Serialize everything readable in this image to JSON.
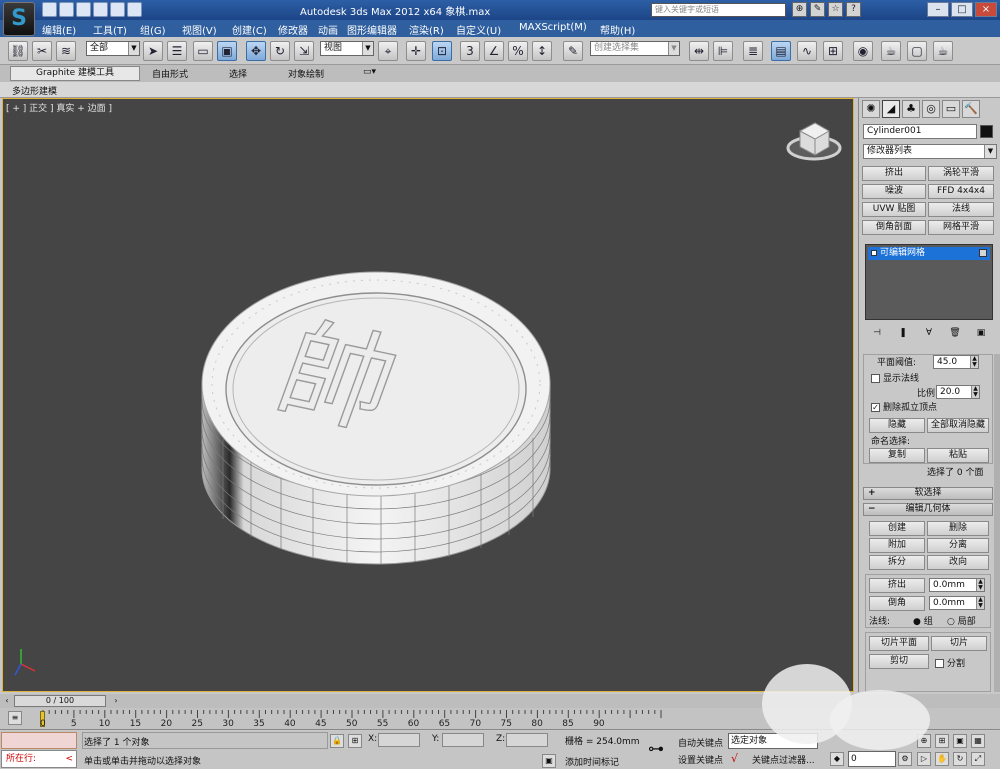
{
  "window": {
    "title": "Autodesk 3ds Max  2012 x64      象棋.max",
    "search_placeholder": "键入关键字或短语",
    "logo": "S"
  },
  "menu": [
    "编辑(E)",
    "工具(T)",
    "组(G)",
    "视图(V)",
    "创建(C)",
    "修改器",
    "动画",
    "图形编辑器",
    "渲染(R)",
    "自定义(U)",
    "MAXScript(M)",
    "帮助(H)"
  ],
  "toolbar": {
    "selection_filter": "全部",
    "reference_coord": "视图",
    "named_selection_placeholder": "创建选择集",
    "snap_label": "3"
  },
  "ribbon": {
    "tabs": [
      "Graphite 建模工具",
      "自由形式",
      "选择",
      "对象绘制"
    ],
    "subpanel": "多边形建模"
  },
  "viewport": {
    "label": "[ + ] 正交 ] 真实 + 边面 ]",
    "object_glyph": "帥"
  },
  "command_panel": {
    "object_name": "Cylinder001",
    "modifier_list": "修改器列表",
    "modifier_buttons": [
      "挤出",
      "涡轮平滑",
      "噪波",
      "FFD 4x4x4",
      "UVW 贴图",
      "法线",
      "倒角剖面",
      "网格平滑"
    ],
    "stack_item": "可编辑网格",
    "threshold_label": "平面阈值:",
    "threshold_value": "45.0",
    "show_normals": "显示法线",
    "scale_label": "比例:",
    "scale_value": "20.0",
    "delete_isolated": "删除孤立顶点",
    "hide": "隐藏",
    "unhide_all": "全部取消隐藏",
    "named_selection": "命名选择:",
    "copy": "复制",
    "paste": "粘贴",
    "selection_status": "选择了 0 个面",
    "soft_selection": "软选择",
    "edit_geometry": "编辑几何体",
    "create": "创建",
    "delete": "删除",
    "attach": "附加",
    "detach": "分离",
    "split": "拆分",
    "turn": "改向",
    "extrude": "挤出",
    "extrude_value": "0.0mm",
    "chamfer": "倒角",
    "chamfer_value": "0.0mm",
    "normal_label": "法线:",
    "normal_group": "组",
    "normal_local": "局部",
    "slice_plane": "切片平面",
    "slice": "切片",
    "cut": "剪切",
    "split_check": "分割"
  },
  "timeline": {
    "frame": "0 / 100",
    "ticks": [
      "0",
      "5",
      "10",
      "15",
      "20",
      "25",
      "30",
      "35",
      "40",
      "45",
      "50",
      "55",
      "60",
      "65",
      "70",
      "75",
      "80",
      "85",
      "90"
    ]
  },
  "status": {
    "running": "所在行:",
    "selected": "选择了 1 个对象",
    "prompt": "单击或单击并拖动以选择对象",
    "x_label": "X:",
    "y_label": "Y:",
    "z_label": "Z:",
    "grid": "栅格 = 254.0mm",
    "add_time_tag": "添加时间标记",
    "auto_key": "自动关键点",
    "selected_object": "选定对象",
    "set_key": "设置关键点",
    "key_filters": "关键点过滤器...",
    "frame_value": "0"
  }
}
